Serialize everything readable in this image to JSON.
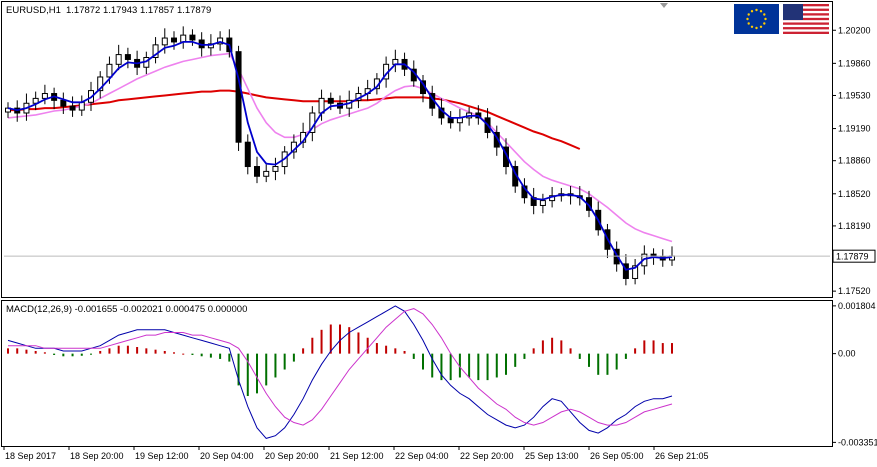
{
  "header": {
    "symbol_timeframe": "EURUSD,H1",
    "ohlc": "1.17872 1.17943 1.17857 1.17879"
  },
  "icons": {
    "flag_left": "eu-flag-icon",
    "flag_right": "us-flag-icon"
  },
  "colors": {
    "background": "#ffffff",
    "candle": "#000000",
    "ma_fast": "#0000cc",
    "ma_slow": "#ee82ee",
    "ma_long": "#dd0000",
    "hist_up": "#c00000",
    "hist_down": "#007000",
    "macd_line": "#0000aa",
    "signal_line": "#cc33cc",
    "grid_label": "#000000",
    "price_box_border": "#000000"
  },
  "chart_data": [
    {
      "type": "candlestick",
      "title": "EURUSD,H1",
      "current_price": 1.17879,
      "current_price_label": "1.17879",
      "y_ticks": [
        "1.20200",
        "1.19860",
        "1.19530",
        "1.19190",
        "1.18860",
        "1.18520",
        "1.18190",
        "1.17520"
      ],
      "y_tick_values": [
        1.202,
        1.1986,
        1.1953,
        1.1919,
        1.1886,
        1.1852,
        1.1819,
        1.1752
      ],
      "ylim": [
        1.1747,
        1.2048
      ],
      "x_ticks": [
        "18 Sep 2017",
        "18 Sep 20:00",
        "19 Sep 12:00",
        "20 Sep 04:00",
        "20 Sep 20:00",
        "21 Sep 12:00",
        "22 Sep 04:00",
        "22 Sep 20:00",
        "25 Sep 13:00",
        "26 Sep 05:00",
        "26 Sep 21:05"
      ],
      "close_path": [
        1.194,
        1.1935,
        1.1945,
        1.195,
        1.1955,
        1.1948,
        1.1942,
        1.1938,
        1.1946,
        1.1958,
        1.1972,
        1.1985,
        1.1995,
        1.199,
        1.1982,
        1.1992,
        1.2005,
        1.2012,
        1.2008,
        1.2015,
        1.201,
        1.2002,
        1.2006,
        1.2012,
        1.1998,
        1.1905,
        1.188,
        1.187,
        1.1875,
        1.188,
        1.1895,
        1.1905,
        1.1915,
        1.1935,
        1.195,
        1.1945,
        1.194,
        1.1948,
        1.1955,
        1.196,
        1.197,
        1.1985,
        1.199,
        1.198,
        1.1968,
        1.1955,
        1.194,
        1.193,
        1.1925,
        1.193,
        1.1935,
        1.193,
        1.1915,
        1.19,
        1.188,
        1.186,
        1.1848,
        1.184,
        1.1845,
        1.185,
        1.1852,
        1.185,
        1.1848,
        1.1835,
        1.1815,
        1.1795,
        1.178,
        1.1765,
        1.1778,
        1.179,
        1.1787,
        1.1784,
        1.1788
      ],
      "ma_fast": [
        1.194,
        1.1938,
        1.194,
        1.1944,
        1.1949,
        1.1952,
        1.1949,
        1.1946,
        1.1946,
        1.1951,
        1.196,
        1.197,
        1.1981,
        1.1987,
        1.1986,
        1.1988,
        1.1995,
        1.2002,
        1.2004,
        1.2008,
        1.2008,
        1.2005,
        1.2005,
        1.2008,
        1.2005,
        1.197,
        1.1925,
        1.1895,
        1.1883,
        1.1882,
        1.1888,
        1.1897,
        1.1906,
        1.192,
        1.1935,
        1.1942,
        1.1943,
        1.1945,
        1.195,
        1.1955,
        1.1962,
        1.1975,
        1.1985,
        1.1985,
        1.1977,
        1.1965,
        1.195,
        1.1938,
        1.193,
        1.193,
        1.1932,
        1.1932,
        1.1923,
        1.191,
        1.1893,
        1.1873,
        1.1858,
        1.1847,
        1.1846,
        1.1849,
        1.1851,
        1.1851,
        1.1849,
        1.184,
        1.1825,
        1.1806,
        1.1789,
        1.1774,
        1.1776,
        1.1785,
        1.1787,
        1.1786,
        1.1787
      ],
      "ma_slow": [
        1.193,
        1.1931,
        1.1932,
        1.1933,
        1.1935,
        1.1937,
        1.1938,
        1.194,
        1.1942,
        1.1945,
        1.195,
        1.1955,
        1.196,
        1.1965,
        1.197,
        1.1974,
        1.1978,
        1.1982,
        1.1985,
        1.1988,
        1.199,
        1.1992,
        1.1994,
        1.1995,
        1.1996,
        1.198,
        1.196,
        1.194,
        1.1925,
        1.1915,
        1.191,
        1.191,
        1.1913,
        1.1918,
        1.1924,
        1.1928,
        1.1931,
        1.1934,
        1.1937,
        1.194,
        1.1945,
        1.1952,
        1.1958,
        1.1962,
        1.1963,
        1.196,
        1.1955,
        1.195,
        1.1945,
        1.194,
        1.1936,
        1.1932,
        1.1925,
        1.1915,
        1.1905,
        1.1895,
        1.1885,
        1.1877,
        1.187,
        1.1866,
        1.1863,
        1.186,
        1.1857,
        1.1852,
        1.1845,
        1.1838,
        1.183,
        1.1822,
        1.1816,
        1.1812,
        1.1809,
        1.1806,
        1.1803
      ],
      "ma_long": [
        1.1938,
        1.1938,
        1.1939,
        1.1939,
        1.194,
        1.194,
        1.1941,
        1.1942,
        1.1943,
        1.1944,
        1.1945,
        1.1946,
        1.1948,
        1.1949,
        1.195,
        1.1951,
        1.1952,
        1.1953,
        1.1954,
        1.1955,
        1.1956,
        1.1957,
        1.1957,
        1.1958,
        1.1958,
        1.1957,
        1.1955,
        1.1953,
        1.1951,
        1.195,
        1.1949,
        1.1948,
        1.1947,
        1.1947,
        1.1947,
        1.1947,
        1.1947,
        1.1947,
        1.1948,
        1.1948,
        1.1949,
        1.195,
        1.1951,
        1.1951,
        1.1951,
        1.1951,
        1.195,
        1.1949,
        1.1947,
        1.1945,
        1.1942,
        1.1939,
        1.1936,
        1.1932,
        1.1928,
        1.1924,
        1.192,
        1.1916,
        1.1913,
        1.1909,
        1.1906,
        1.1902,
        1.1898
      ]
    },
    {
      "type": "macd",
      "title": "MACD(12,26,9) -0.001655 -0.002021 0.000475 0.000000",
      "params": "12,26,9",
      "y_ticks": [
        "0.001804",
        "0.00",
        "-0.003351"
      ],
      "y_tick_values": [
        0.001804,
        0.0,
        -0.003351
      ],
      "ylim": [
        -0.00345,
        0.00195
      ],
      "histogram": [
        0.0002,
        0.0002,
        0.00015,
        0.0001,
        5e-05,
        -5e-05,
        -0.0001,
        -0.0001,
        -8e-05,
        -4e-05,
        0.0001,
        0.0002,
        0.0003,
        0.0003,
        0.00025,
        0.0002,
        0.00015,
        0.0001,
        5e-05,
        0.0,
        -5e-05,
        -0.0001,
        -0.00015,
        -0.0002,
        -0.0003,
        -0.0012,
        -0.0016,
        -0.0015,
        -0.0012,
        -0.0009,
        -0.0006,
        -0.0003,
        0.0002,
        0.0006,
        0.0009,
        0.0011,
        0.0011,
        0.001,
        0.0008,
        0.0006,
        0.0004,
        0.0003,
        0.0002,
        0.0001,
        -0.0002,
        -0.0006,
        -0.0009,
        -0.001,
        -0.001,
        -0.0009,
        -0.0009,
        -0.001,
        -0.001,
        -0.0009,
        -0.0008,
        -0.0005,
        -0.0002,
        0.0002,
        0.0005,
        0.0006,
        0.0005,
        0.0002,
        -0.0002,
        -0.0005,
        -0.0008,
        -0.0008,
        -0.0006,
        -0.0002,
        0.0002,
        0.0005,
        0.0005,
        0.0004,
        0.0004
      ],
      "macd_line": [
        0.0005,
        0.0004,
        0.0003,
        0.0002,
        0.0002,
        0.0002,
        0.0001,
        0.0001,
        0.0001,
        0.0002,
        0.0003,
        0.0005,
        0.0007,
        0.0008,
        0.0009,
        0.0009,
        0.0009,
        0.0009,
        0.0008,
        0.0007,
        0.0006,
        0.0005,
        0.0004,
        0.0003,
        0.0002,
        -0.001,
        -0.002,
        -0.0028,
        -0.0032,
        -0.0031,
        -0.0028,
        -0.0023,
        -0.0017,
        -0.001,
        -0.0004,
        0.0001,
        0.0005,
        0.0008,
        0.001,
        0.0012,
        0.0014,
        0.0016,
        0.0018,
        0.0016,
        0.0011,
        0.0005,
        -0.0002,
        -0.0008,
        -0.0012,
        -0.0015,
        -0.0017,
        -0.002,
        -0.0023,
        -0.0025,
        -0.0027,
        -0.0028,
        -0.0027,
        -0.0024,
        -0.002,
        -0.0017,
        -0.0018,
        -0.0022,
        -0.0026,
        -0.0029,
        -0.003,
        -0.0028,
        -0.0025,
        -0.0023,
        -0.002,
        -0.0018,
        -0.0017,
        -0.0017,
        -0.0016
      ],
      "signal_line": [
        0.0003,
        0.0003,
        0.0003,
        0.0003,
        0.0002,
        0.0002,
        0.0002,
        0.0002,
        0.0002,
        0.0002,
        0.0002,
        0.0003,
        0.0004,
        0.0005,
        0.0006,
        0.0007,
        0.0007,
        0.0008,
        0.0008,
        0.0008,
        0.0007,
        0.0007,
        0.0006,
        0.0005,
        0.0004,
        0.0002,
        -0.0003,
        -0.0009,
        -0.0015,
        -0.002,
        -0.0024,
        -0.0026,
        -0.0027,
        -0.0025,
        -0.0021,
        -0.0016,
        -0.0011,
        -0.0006,
        -0.0002,
        0.0002,
        0.0006,
        0.001,
        0.0013,
        0.0016,
        0.0017,
        0.0015,
        0.0011,
        0.0006,
        0.0,
        -0.0005,
        -0.0009,
        -0.0013,
        -0.0016,
        -0.0019,
        -0.0021,
        -0.0024,
        -0.0026,
        -0.0027,
        -0.0026,
        -0.0024,
        -0.0022,
        -0.0021,
        -0.0022,
        -0.0024,
        -0.0026,
        -0.0027,
        -0.0027,
        -0.0026,
        -0.0024,
        -0.0022,
        -0.0021,
        -0.002,
        -0.0019
      ]
    }
  ]
}
